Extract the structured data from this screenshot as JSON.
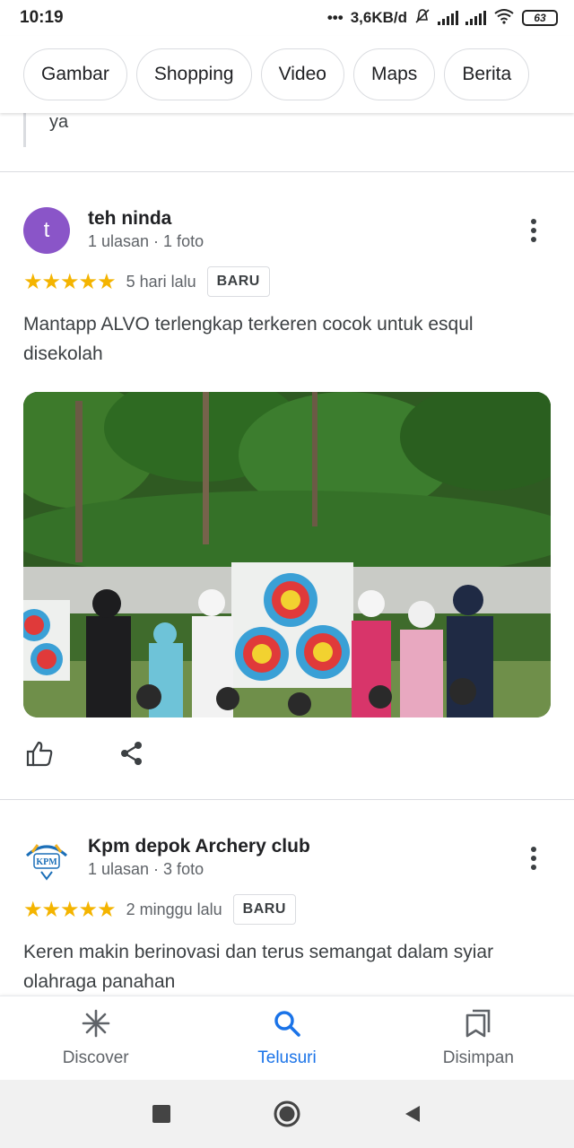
{
  "status": {
    "time": "10:19",
    "net_speed": "3,6KB/d",
    "battery": "63"
  },
  "chips": [
    "Gambar",
    "Shopping",
    "Video",
    "Maps",
    "Berita"
  ],
  "previous_review_tail": "ya",
  "reviews": [
    {
      "avatar_letter": "t",
      "name": "teh ninda",
      "meta": "1 ulasan · 1 foto",
      "stars": "★★★★★",
      "date": "5 hari lalu",
      "badge": "BARU",
      "text": "Mantapp ALVO terlengkap terkeren cocok untuk esqul disekolah",
      "photo_alt": "archery-group-photo"
    },
    {
      "avatar_logo_text": "KPM",
      "name": "Kpm depok Archery club",
      "meta": "1 ulasan · 3 foto",
      "stars": "★★★★★",
      "date": "2 minggu lalu",
      "badge": "BARU",
      "text": "Keren makin berinovasi dan terus semangat dalam syiar olahraga panahan"
    }
  ],
  "bottom_nav": [
    {
      "label": "Discover",
      "icon": "asterisk-icon",
      "active": false
    },
    {
      "label": "Telusuri",
      "icon": "search-icon",
      "active": true
    },
    {
      "label": "Disimpan",
      "icon": "bookmarks-icon",
      "active": false
    }
  ],
  "colors": {
    "accent": "#1a73e8",
    "star": "#f4b400",
    "avatar_purple": "#8a55c8"
  }
}
